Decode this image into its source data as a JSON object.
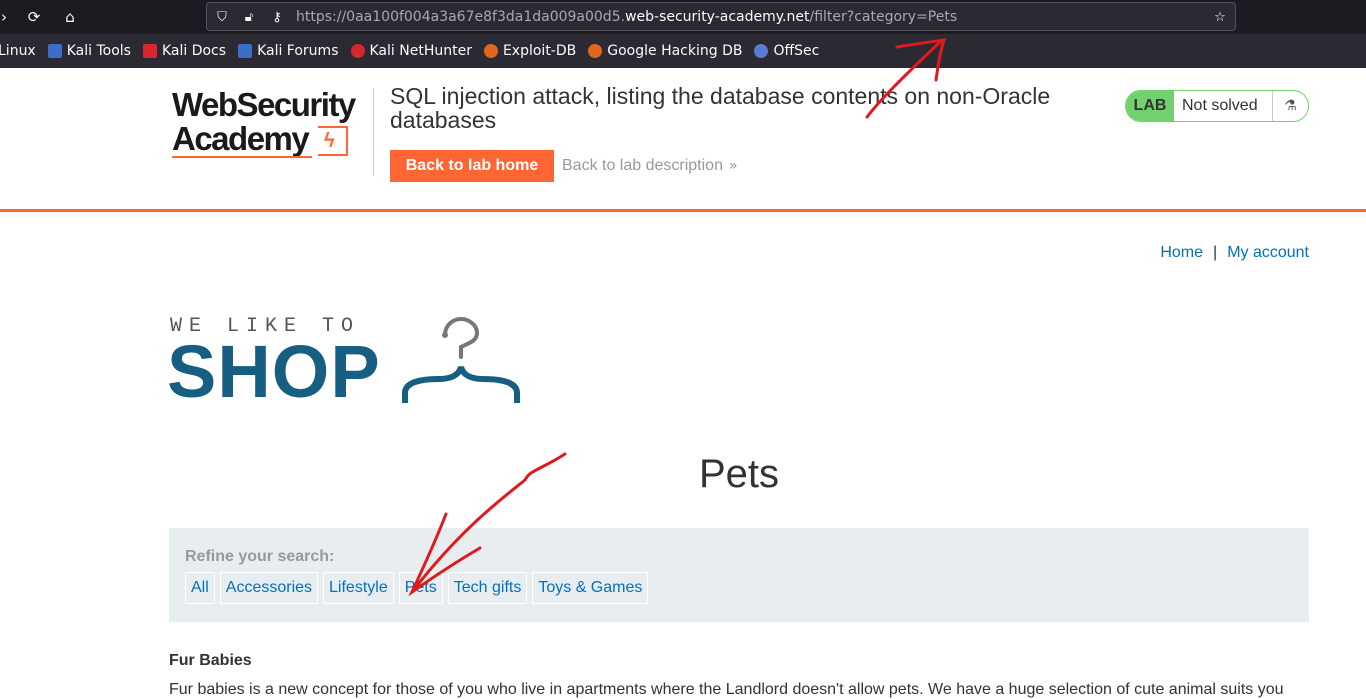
{
  "browser": {
    "url_prefix": "https://0aa100f004a3a67e8f3da1da009a00d5.",
    "url_host": "web-security-academy.net",
    "url_path": "/filter?category=Pets",
    "bookmarks": [
      {
        "label": "Linux",
        "icon": "kali-linux-icon",
        "color": "#2b2a33"
      },
      {
        "label": "Kali Tools",
        "icon": "kali-tools-icon",
        "color": "#3b6ec6"
      },
      {
        "label": "Kali Docs",
        "icon": "kali-docs-icon",
        "color": "#d7262e"
      },
      {
        "label": "Kali Forums",
        "icon": "kali-forums-icon",
        "color": "#3b6ec6"
      },
      {
        "label": "Kali NetHunter",
        "icon": "kali-nethunter-icon",
        "color": "#d7262e"
      },
      {
        "label": "Exploit-DB",
        "icon": "exploit-db-icon",
        "color": "#e0661c"
      },
      {
        "label": "Google Hacking DB",
        "icon": "google-hacking-db-icon",
        "color": "#e0661c"
      },
      {
        "label": "OffSec",
        "icon": "offsec-icon",
        "color": "#5a7bd6"
      }
    ]
  },
  "lab": {
    "logo_line1": "WebSecurity",
    "logo_line2": "Academy",
    "title": "SQL injection attack, listing the database contents on non-Oracle databases",
    "back_home": "Back to lab home",
    "back_description": "Back to lab description",
    "badge": "LAB",
    "status": "Not solved"
  },
  "nav": {
    "home": "Home",
    "separator": "|",
    "account": "My account"
  },
  "shop_logo": {
    "tagline": "WE LIKE TO",
    "word": "SHOP"
  },
  "page": {
    "heading": "Pets"
  },
  "filter": {
    "label": "Refine your search:",
    "categories": [
      "All",
      "Accessories",
      "Lifestyle",
      "Pets",
      "Tech gifts",
      "Toys & Games"
    ]
  },
  "product": {
    "title": "Fur Babies",
    "description": "Fur babies is a new concept for those of you who live in apartments where the Landlord doesn't allow pets. We have a huge selection of cute animal suits you"
  },
  "colors": {
    "accent": "#ff6633",
    "link": "#0071bc",
    "shop_blue": "#175f82",
    "lab_green": "#70d16d",
    "annotation_red": "#e0191c"
  }
}
